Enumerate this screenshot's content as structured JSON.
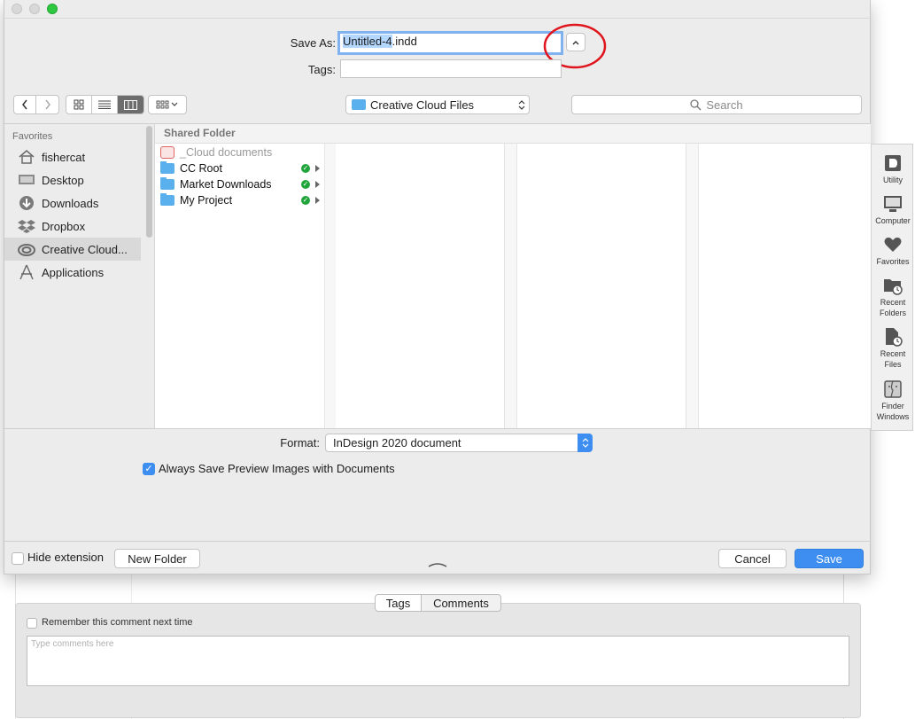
{
  "dialog": {
    "save_as_label": "Save As:",
    "filename_selected": "Untitled-4",
    "filename_ext": ".indd",
    "tags_label": "Tags:",
    "tags_value": "",
    "expand_toggle_glyph": "^"
  },
  "toolbar": {
    "location": "Creative Cloud Files",
    "search_placeholder": "Search"
  },
  "sidebar": {
    "section_title": "Favorites",
    "items": [
      {
        "label": "fishercat",
        "icon": "home-icon"
      },
      {
        "label": "Desktop",
        "icon": "desktop-icon"
      },
      {
        "label": "Downloads",
        "icon": "downloads-icon"
      },
      {
        "label": "Dropbox",
        "icon": "dropbox-icon"
      },
      {
        "label": "Creative Cloud...",
        "icon": "creative-cloud-icon",
        "active": true
      },
      {
        "label": "Applications",
        "icon": "applications-icon"
      }
    ]
  },
  "browser": {
    "header": "Shared Folder",
    "items": [
      {
        "label": "_Cloud documents",
        "dimmed": true
      },
      {
        "label": "CC Root",
        "synced": true
      },
      {
        "label": "Market Downloads",
        "synced": true
      },
      {
        "label": "My Project",
        "synced": true
      }
    ]
  },
  "options": {
    "format_label": "Format:",
    "format_value": "InDesign 2020 document",
    "preview_checkbox_label": "Always Save Preview Images with Documents",
    "preview_checked": true
  },
  "footer": {
    "hide_extension_label": "Hide extension",
    "new_folder_label": "New Folder",
    "cancel_label": "Cancel",
    "save_label": "Save"
  },
  "right_panel": {
    "items": [
      {
        "label": "Utility"
      },
      {
        "label": "Computer"
      },
      {
        "label": "Favorites"
      },
      {
        "label": "Recent Folders"
      },
      {
        "label": "Recent Files"
      },
      {
        "label": "Finder Windows"
      }
    ]
  },
  "background_panel": {
    "tabs": [
      "Tags",
      "Comments"
    ],
    "remember_label": "Remember this comment next time",
    "comments_placeholder": "Type comments here"
  },
  "colors": {
    "accent": "#3d8ef0",
    "sync_green": "#1fa53a",
    "folder_blue": "#5ab0ec",
    "annotation_red": "#e0141c"
  }
}
